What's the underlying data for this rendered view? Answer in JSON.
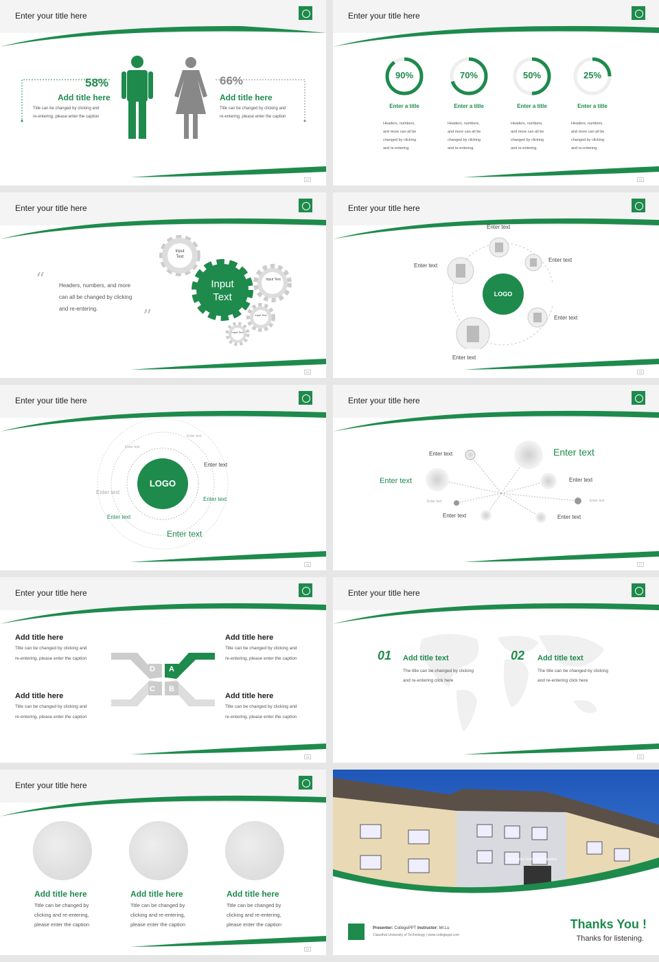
{
  "slides": {
    "title": "Enter your title here",
    "s1": {
      "left_pct": "58%",
      "left_title": "Add title here",
      "left_desc1": "Title can be changed by clicking and",
      "left_desc2": "re-entering, please enter the caption",
      "right_pct": "66%",
      "right_title": "Add title here",
      "right_desc1": "Title can be changed by clicking and",
      "right_desc2": "re-entering, please enter the caption",
      "page": "12"
    },
    "s2": {
      "rings": [
        {
          "label": "90%",
          "value": 0.9,
          "title": "Enter a title"
        },
        {
          "label": "70%",
          "value": 0.7,
          "title": "Enter a title"
        },
        {
          "label": "50%",
          "value": 0.5,
          "title": "Enter a title"
        },
        {
          "label": "25%",
          "value": 0.25,
          "title": "Enter a title"
        }
      ],
      "desc1": "Headers, numbers,",
      "desc2": "and more can all be",
      "desc3": "changed by clicking",
      "desc4": "and re-entering.",
      "page": "13"
    },
    "s3": {
      "gear_big1": "Input",
      "gear_big2": "Text",
      "gear_small": "Input Text",
      "quote1": "Headers, numbers, and more",
      "quote2": "can all be changed by clicking",
      "quote3": "and re-entering.",
      "open_quote": "“",
      "close_quote": "”",
      "page": "14"
    },
    "s4": {
      "logo": "LOGO",
      "labels": [
        "Enter text",
        "Enter text",
        "Enter text",
        "Enter text",
        "Enter text"
      ],
      "page": "15"
    },
    "s5": {
      "logo": "LOGO",
      "labels": [
        "Enter text",
        "Enter text",
        "Enter text",
        "Enter text",
        "Enter text",
        "Enter text",
        "Enter text",
        "Enter text"
      ],
      "page": "16"
    },
    "s6": {
      "big": "Enter text",
      "left": "Enter text",
      "labels": [
        "Enter text",
        "Enter text",
        "Enter text",
        "Enter text",
        "Enter text"
      ],
      "tiny1": "Enter text",
      "tiny2": "Enter text",
      "page": "17"
    },
    "s7": {
      "title": "Add title here",
      "desc1": "Title can be changed by clicking and",
      "desc2": "re-entering, please enter the caption",
      "letters": [
        "D",
        "A",
        "C",
        "B"
      ],
      "page": "18"
    },
    "s8": {
      "n1": "01",
      "t1": "Add title text",
      "d1a": "The title can be changed by clicking",
      "d1b": "and re-entering click here",
      "n2": "02",
      "t2": "Add title text",
      "d2a": "The title can be changed by clicking",
      "d2b": "and re-entering click here",
      "page": "19"
    },
    "s9": {
      "title": "Add title here",
      "desc1": "Title can be changed by",
      "desc2": "clicking and re-entering,",
      "desc3": "please enter the caption",
      "page": "19"
    },
    "s10": {
      "presenter_label": "Presenter:",
      "presenter": "CollegePPT",
      "instructor_label": "Instructor:",
      "instructor": "Mr.Lu",
      "org": "Clausthal University of Technology  |  www.collegeppt.com",
      "building_sign": "Technische Universität Clausthal",
      "thanks": "Thanks You !",
      "thanks_sub": "Thanks for listening."
    }
  },
  "colors": {
    "accent": "#1e8a4c",
    "gray": "#8c8c8c",
    "light": "#d9d9d9"
  }
}
